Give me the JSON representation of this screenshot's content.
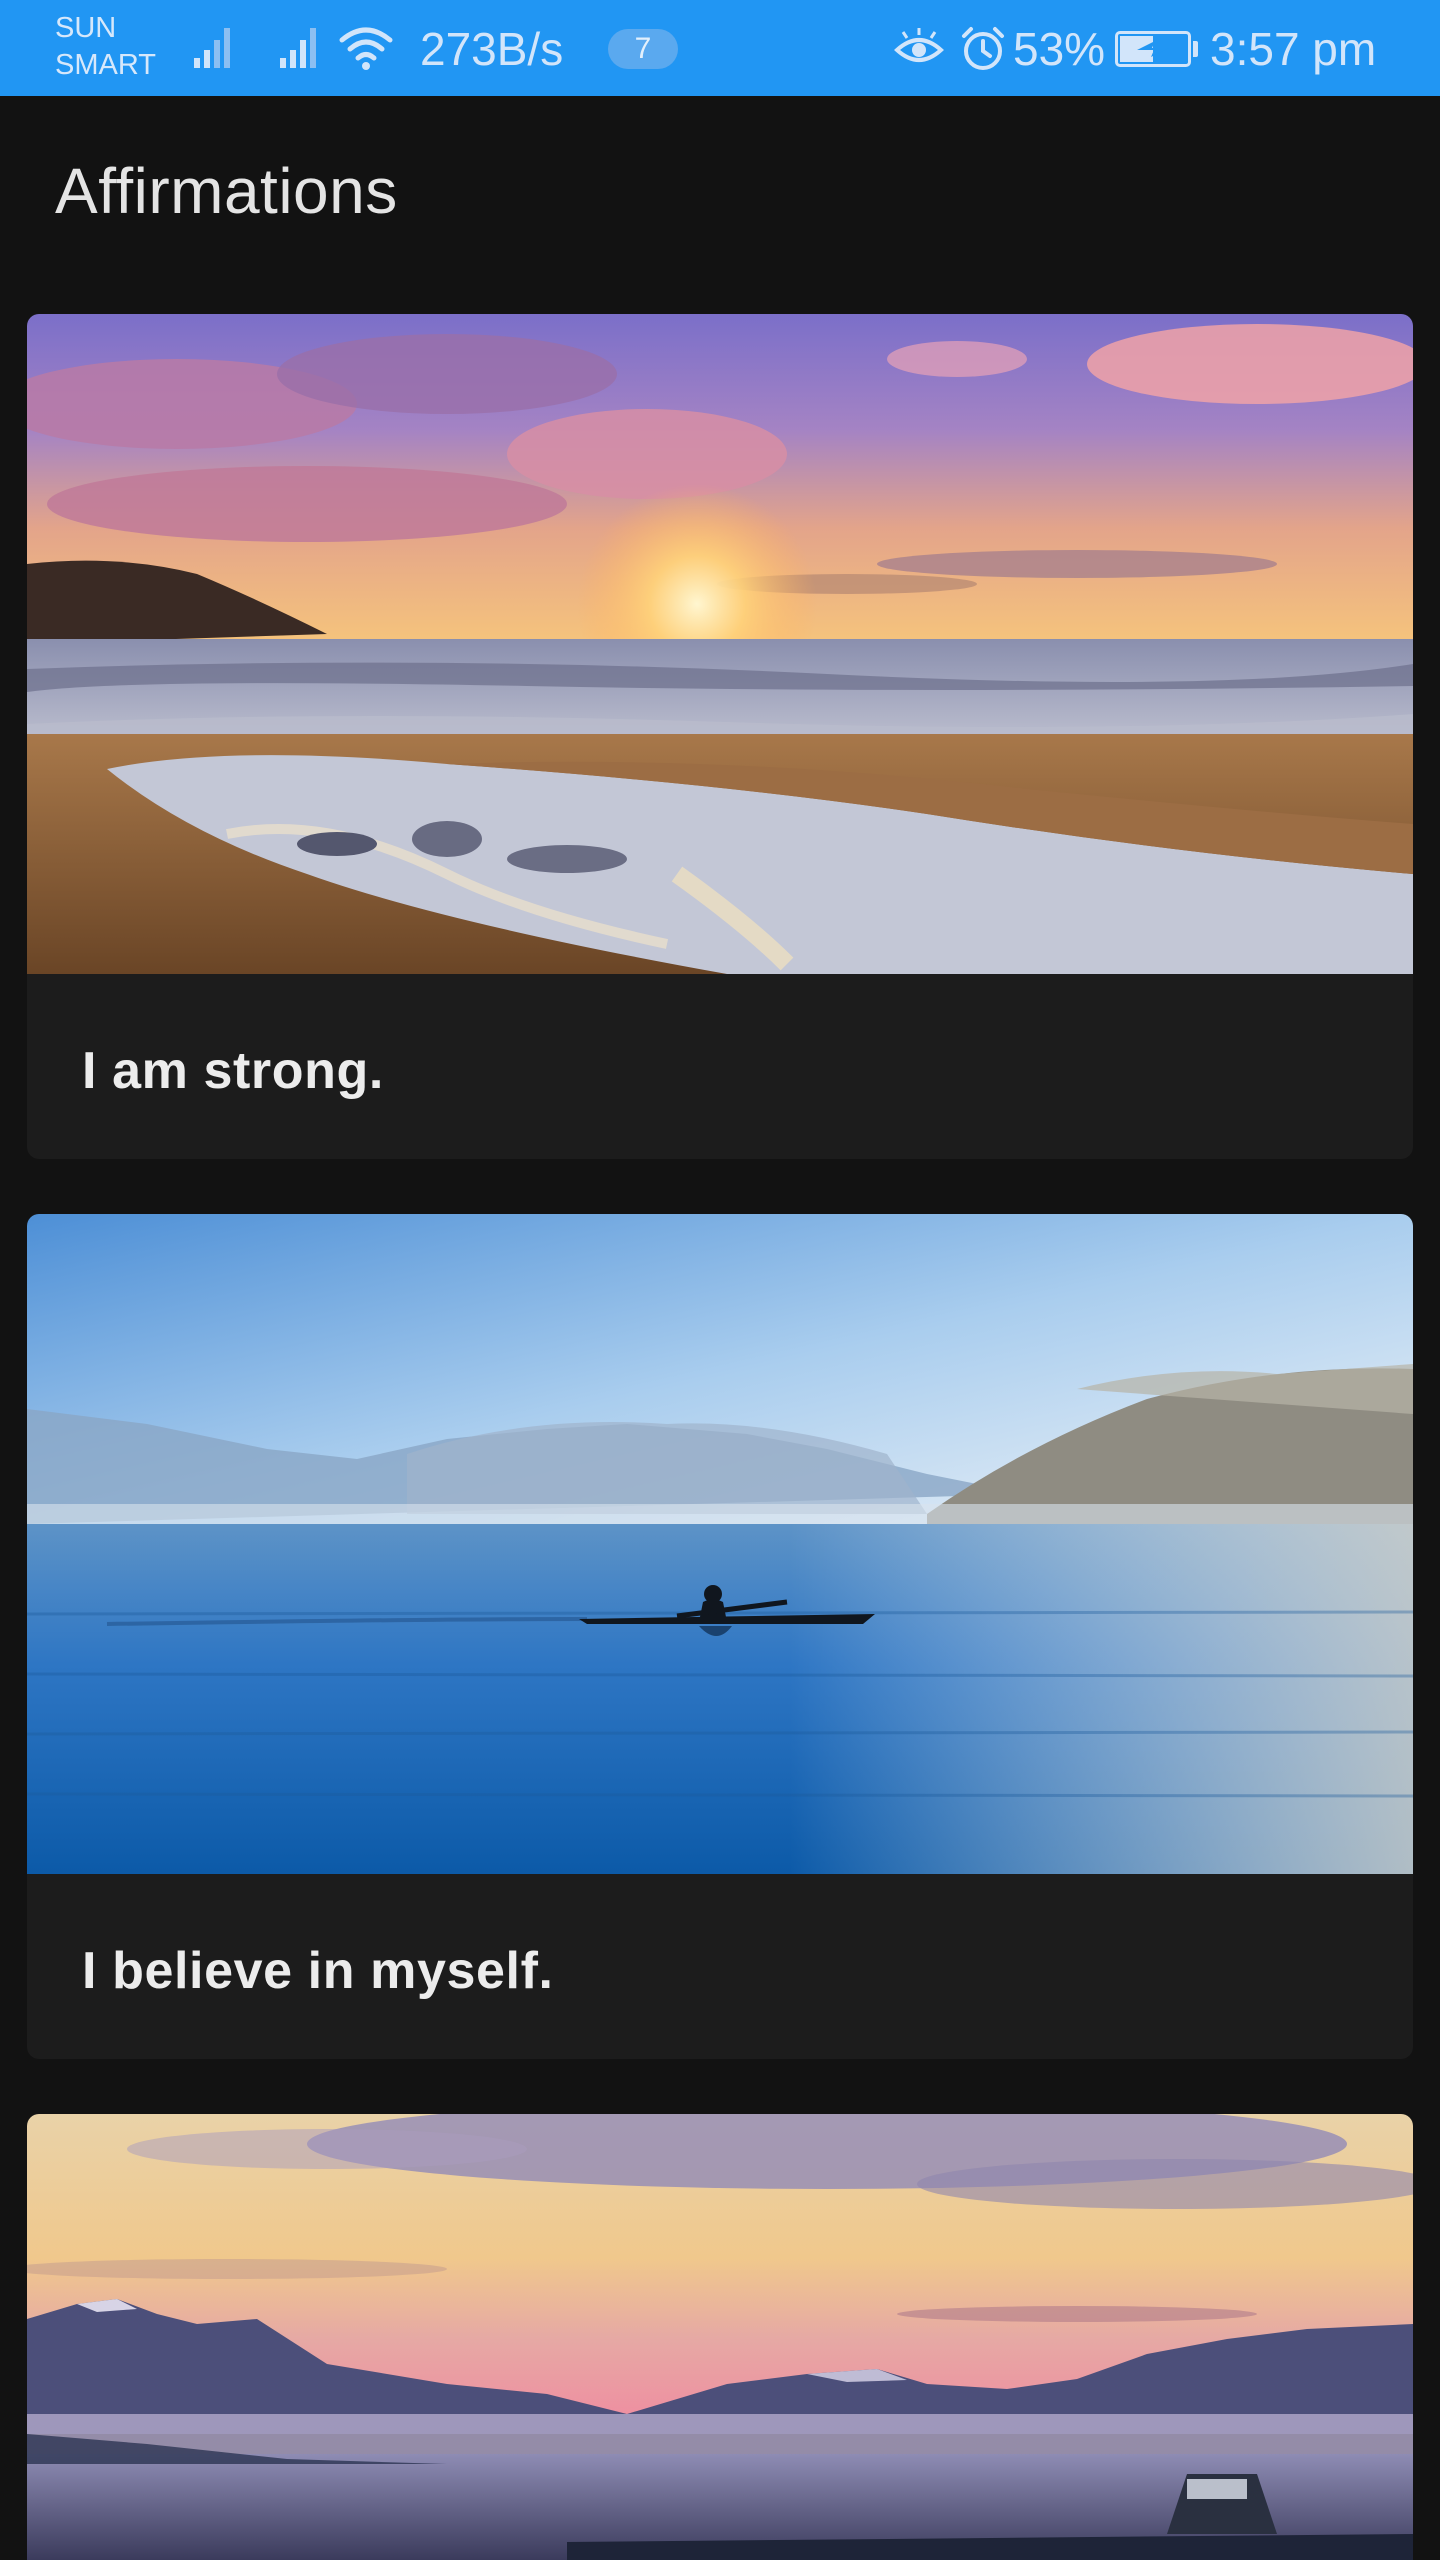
{
  "status_bar": {
    "carrier_line1": "SUN",
    "carrier_line2": "SMART",
    "net_speed": "273B/s",
    "notification_count": "7",
    "battery_percent": "53%",
    "battery_level": 0.53,
    "time": "3:57 pm",
    "icons": [
      "signal-icon",
      "signal-icon",
      "wifi-icon",
      "eye-icon",
      "alarm-icon",
      "battery-icon"
    ]
  },
  "header": {
    "title": "Affirmations"
  },
  "affirmations": [
    {
      "text": "I am strong.",
      "image": "beach-sunset-image"
    },
    {
      "text": "I believe in myself.",
      "image": "lake-kayaker-image"
    },
    {
      "text": "",
      "image": "mountain-lake-dusk-image"
    }
  ],
  "colors": {
    "status_bar": "#2196f3",
    "background": "#121212",
    "card": "#1c1c1c",
    "text": "#ececec"
  }
}
